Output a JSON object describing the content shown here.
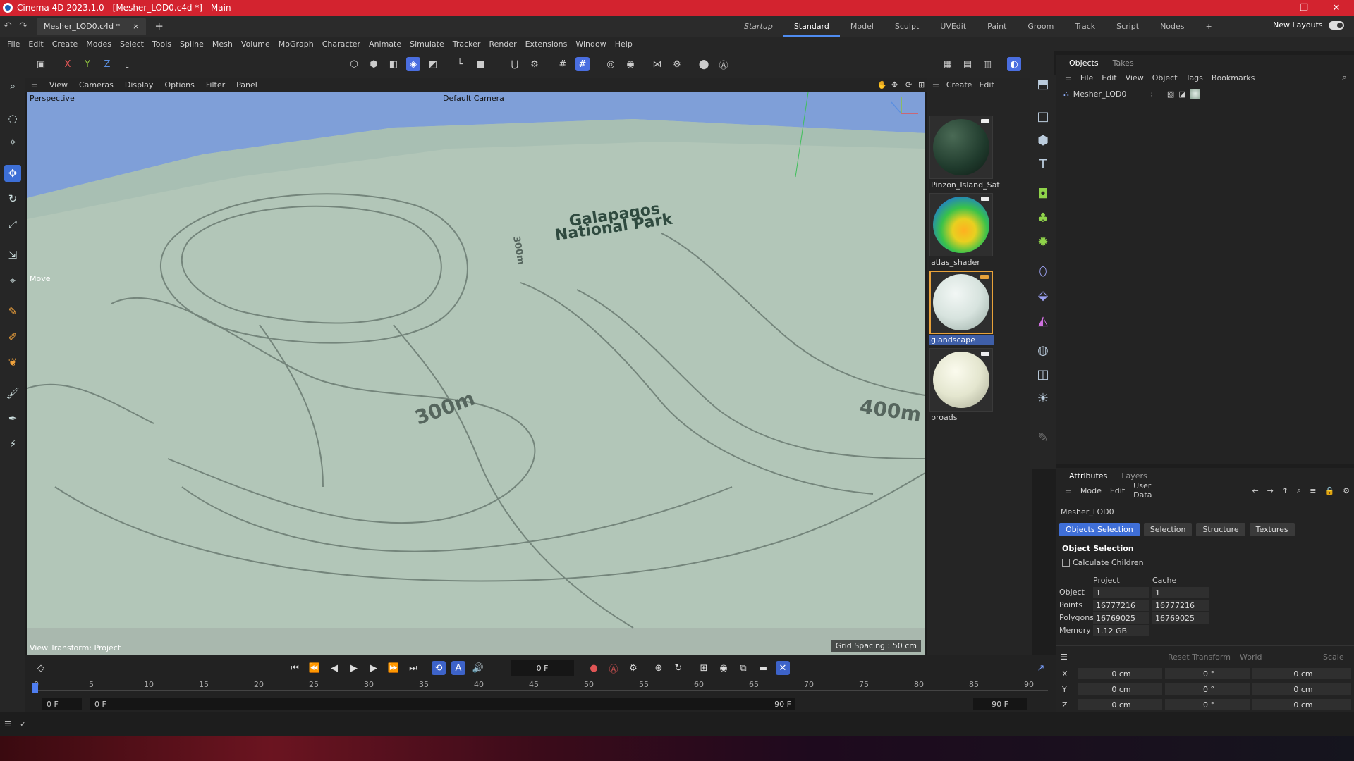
{
  "titlebar": {
    "title": "Cinema 4D 2023.1.0 - [Mesher_LOD0.c4d *] - Main",
    "minimize": "–",
    "restore": "❐",
    "close": "✕"
  },
  "tabs": {
    "document": "Mesher_LOD0.c4d *",
    "close": "×",
    "add": "+"
  },
  "layouts": {
    "items": [
      "Startup",
      "Standard",
      "Model",
      "Sculpt",
      "UVEdit",
      "Paint",
      "Groom",
      "Track",
      "Script",
      "Nodes"
    ],
    "active": "Standard",
    "new_layouts": "New Layouts"
  },
  "menubar": [
    "File",
    "Edit",
    "Create",
    "Modes",
    "Select",
    "Tools",
    "Spline",
    "Mesh",
    "Volume",
    "MoGraph",
    "Character",
    "Animate",
    "Simulate",
    "Tracker",
    "Render",
    "Extensions",
    "Window",
    "Help"
  ],
  "toolbar": {
    "x": "X",
    "y": "Y",
    "z": "Z"
  },
  "viewport_menu": [
    "View",
    "Cameras",
    "Display",
    "Options",
    "Filter",
    "Panel"
  ],
  "viewport": {
    "projection": "Perspective",
    "camera": "Default Camera",
    "tool_label": "Move",
    "view_transform": "View Transform: Project",
    "grid_spacing": "Grid Spacing : 50 cm",
    "terrain_labels": {
      "park_line1": "Galapagos",
      "park_line2": "National Park",
      "contour_300": "300m",
      "contour_400": "400m",
      "contour_small": "300m"
    },
    "colors": {
      "terrain": "#b2c6b8",
      "sky": "#7f9fd8",
      "contour": "#5a6a62"
    }
  },
  "material_panel": {
    "menu": [
      "Create",
      "Edit"
    ],
    "materials": [
      {
        "name": "Pinzon_Island_Sat",
        "color": "#1f3a2c",
        "selected": false
      },
      {
        "name": "atlas_shader",
        "color": "#39c24a",
        "selected": false
      },
      {
        "name": "glandscape",
        "color": "#d7e3de",
        "selected": true
      },
      {
        "name": "broads",
        "color": "#e4e6cf",
        "selected": false
      }
    ]
  },
  "objects_panel": {
    "tabs": [
      "Objects",
      "Takes"
    ],
    "active_tab": "Objects",
    "menu": [
      "File",
      "Edit",
      "View",
      "Object",
      "Tags",
      "Bookmarks"
    ],
    "objects": [
      {
        "name": "Mesher_LOD0"
      }
    ]
  },
  "attributes_panel": {
    "tabs": [
      "Attributes",
      "Layers"
    ],
    "active_tab": "Attributes",
    "menu": [
      "Mode",
      "Edit",
      "User Data"
    ],
    "object_name": "Mesher_LOD0",
    "subtabs": [
      "Objects Selection",
      "Selection",
      "Structure",
      "Textures"
    ],
    "active_subtab": "Objects Selection",
    "section": "Object Selection",
    "calculate_children": "Calculate Children",
    "headers": {
      "project": "Project",
      "cache": "Cache"
    },
    "rows": [
      {
        "label": "Object",
        "project": "1",
        "cache": "1"
      },
      {
        "label": "Points",
        "project": "16777216",
        "cache": "16777216"
      },
      {
        "label": "Polygons",
        "project": "16769025",
        "cache": "16769025"
      },
      {
        "label": "Memory",
        "project": "1.12 GB",
        "cache": ""
      }
    ]
  },
  "coordinates": {
    "reset_transform": "Reset Transform",
    "space": "World",
    "mode": "Scale",
    "rows": [
      {
        "axis": "X",
        "pos": "0 cm",
        "rot": "0 °",
        "scale": "0 cm"
      },
      {
        "axis": "Y",
        "pos": "0 cm",
        "rot": "0 °",
        "scale": "0 cm"
      },
      {
        "axis": "Z",
        "pos": "0 cm",
        "rot": "0 °",
        "scale": "0 cm"
      }
    ]
  },
  "timeline": {
    "current_frame": "0 F",
    "ticks": [
      "0",
      "5",
      "10",
      "15",
      "20",
      "25",
      "30",
      "35",
      "40",
      "45",
      "50",
      "55",
      "60",
      "65",
      "70",
      "75",
      "80",
      "85",
      "90"
    ],
    "range_start": "0 F",
    "range_min": "0 F",
    "range_max": "90 F",
    "range_end": "90 F"
  }
}
